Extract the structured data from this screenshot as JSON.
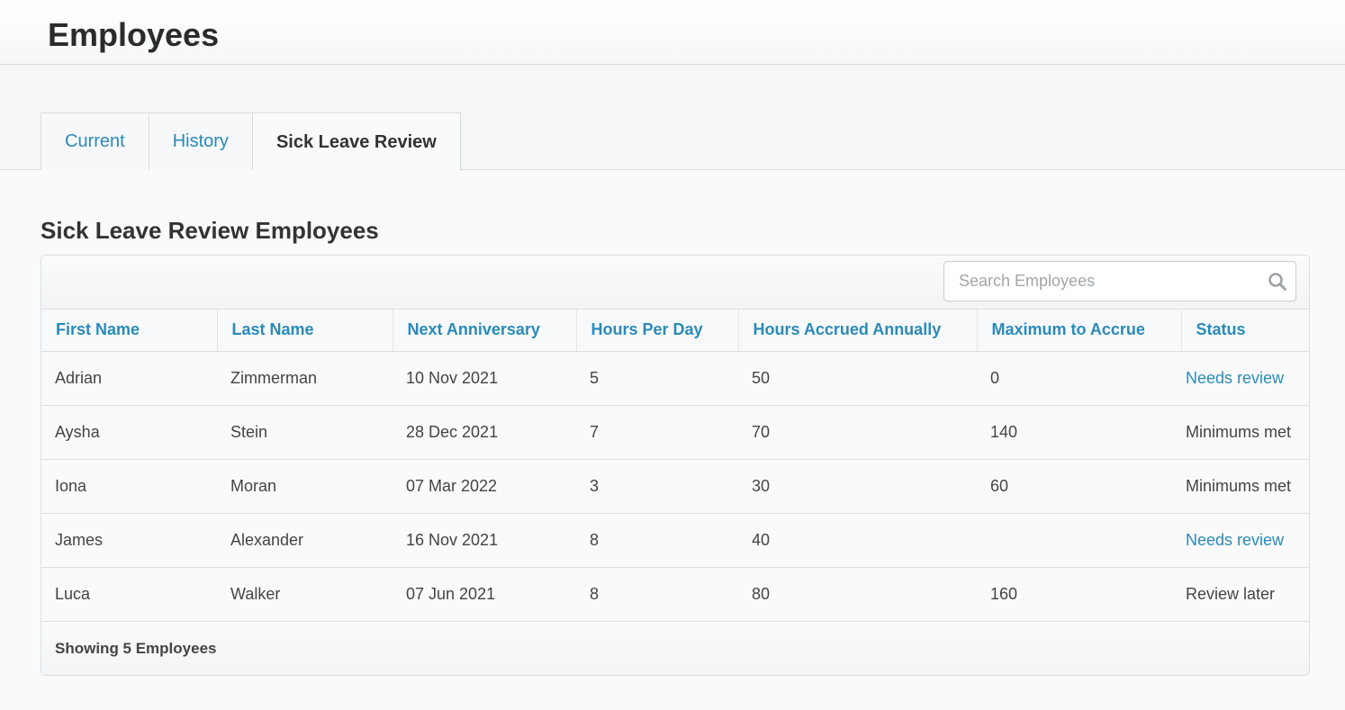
{
  "header": {
    "title": "Employees"
  },
  "tabs": [
    {
      "label": "Current",
      "active": false
    },
    {
      "label": "History",
      "active": false
    },
    {
      "label": "Sick Leave Review",
      "active": true
    }
  ],
  "section": {
    "title": "Sick Leave Review Employees"
  },
  "search": {
    "placeholder": "Search Employees",
    "value": ""
  },
  "table": {
    "columns": [
      "First Name",
      "Last Name",
      "Next Anniversary",
      "Hours Per Day",
      "Hours Accrued Annually",
      "Maximum to Accrue",
      "Status"
    ],
    "rows": [
      {
        "first_name": "Adrian",
        "last_name": "Zimmerman",
        "next_anniversary": "10 Nov 2021",
        "hours_per_day": "5",
        "hours_accrued_annually": "50",
        "maximum_to_accrue": "0",
        "status": "Needs review"
      },
      {
        "first_name": "Aysha",
        "last_name": "Stein",
        "next_anniversary": "28 Dec 2021",
        "hours_per_day": "7",
        "hours_accrued_annually": "70",
        "maximum_to_accrue": "140",
        "status": "Minimums met"
      },
      {
        "first_name": "Iona",
        "last_name": "Moran",
        "next_anniversary": "07 Mar 2022",
        "hours_per_day": "3",
        "hours_accrued_annually": "30",
        "maximum_to_accrue": "60",
        "status": "Minimums met"
      },
      {
        "first_name": "James",
        "last_name": "Alexander",
        "next_anniversary": "16 Nov 2021",
        "hours_per_day": "8",
        "hours_accrued_annually": "40",
        "maximum_to_accrue": "",
        "status": "Needs review"
      },
      {
        "first_name": "Luca",
        "last_name": "Walker",
        "next_anniversary": "07 Jun 2021",
        "hours_per_day": "8",
        "hours_accrued_annually": "80",
        "maximum_to_accrue": "160",
        "status": "Review later"
      }
    ]
  },
  "footer": {
    "summary": "Showing 5 Employees"
  },
  "colors": {
    "accent": "#2a8ab8",
    "text": "#333333",
    "border": "#dcdfe3"
  },
  "icons": {
    "search": "search-icon"
  }
}
